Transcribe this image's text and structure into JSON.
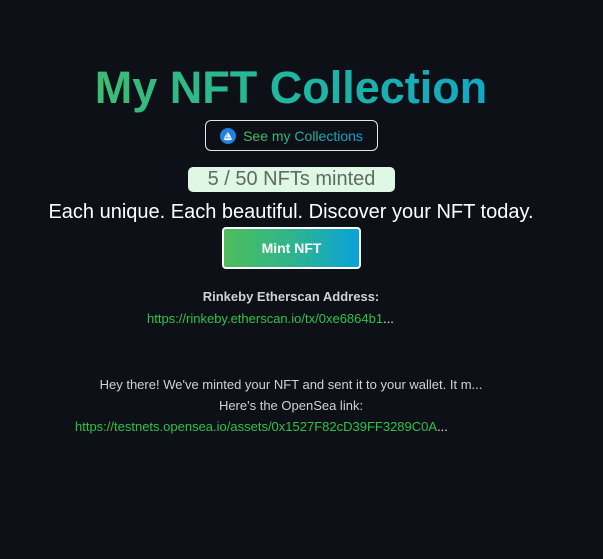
{
  "header": {
    "title": "My NFT Collection"
  },
  "collections_button": {
    "label": "See my Collections",
    "icon": "opensea-icon"
  },
  "minted": {
    "text": "5 / 50 NFTs minted",
    "count": 5,
    "total": 50
  },
  "tagline": "Each unique. Each beautiful. Discover your NFT today.",
  "mint_button": {
    "label": "Mint NFT"
  },
  "etherscan": {
    "label": "Rinkeby Etherscan Address:",
    "link_text": "https://rinkeby.etherscan.io/tx/0xe6864b1",
    "ellipsis": "..."
  },
  "message": {
    "line1": "Hey there! We've minted your NFT and sent it to your wallet. It m...",
    "line2": "Here's the OpenSea link:",
    "link_text": "https://testnets.opensea.io/assets/0x1527F82cD39FF3289C0A",
    "ellipsis": "..."
  },
  "colors": {
    "background": "#0d1117",
    "gradient_start": "#4ebd5a",
    "gradient_end": "#0aa2d9",
    "link": "#2fc14a",
    "badge_bg": "#dff7e4"
  }
}
